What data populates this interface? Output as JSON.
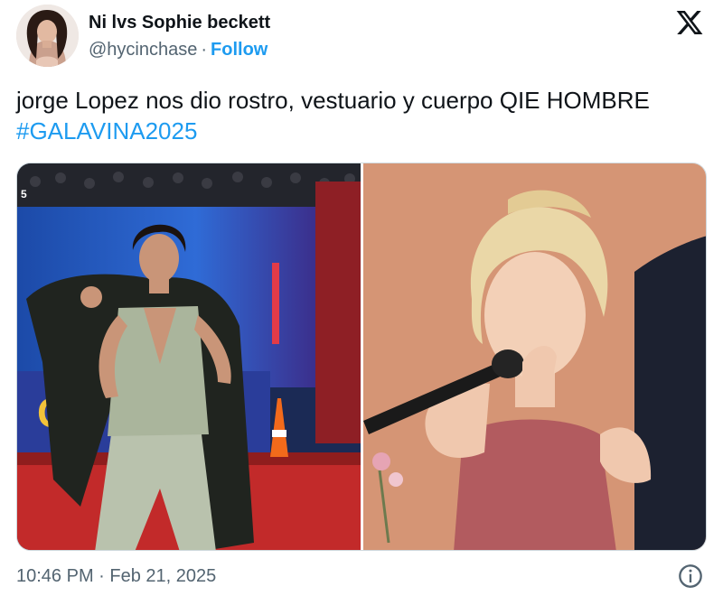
{
  "author": {
    "display_name": "Ni lvs Sophie beckett",
    "handle": "@hycinchase",
    "separator": "·",
    "follow_label": "Follow"
  },
  "platform_icon": "x-logo-icon",
  "tweet": {
    "text": "jorge Lopez nos dio rostro, vestuario y cuerpo QIE HOMBRE ",
    "hashtag": "#GALAVINA2025"
  },
  "media": {
    "photos": [
      {
        "icon": "photo-red-carpet-man",
        "corner_mark": "5",
        "backdrop_letters": "Go"
      },
      {
        "icon": "photo-blonde-woman-microphone"
      }
    ]
  },
  "footer": {
    "time": "10:46 PM",
    "separator": "·",
    "date": "Feb 21, 2025",
    "info_icon": "info-icon"
  },
  "colors": {
    "link": "#1d9bf0",
    "text": "#0f1419",
    "secondary": "#536471"
  }
}
